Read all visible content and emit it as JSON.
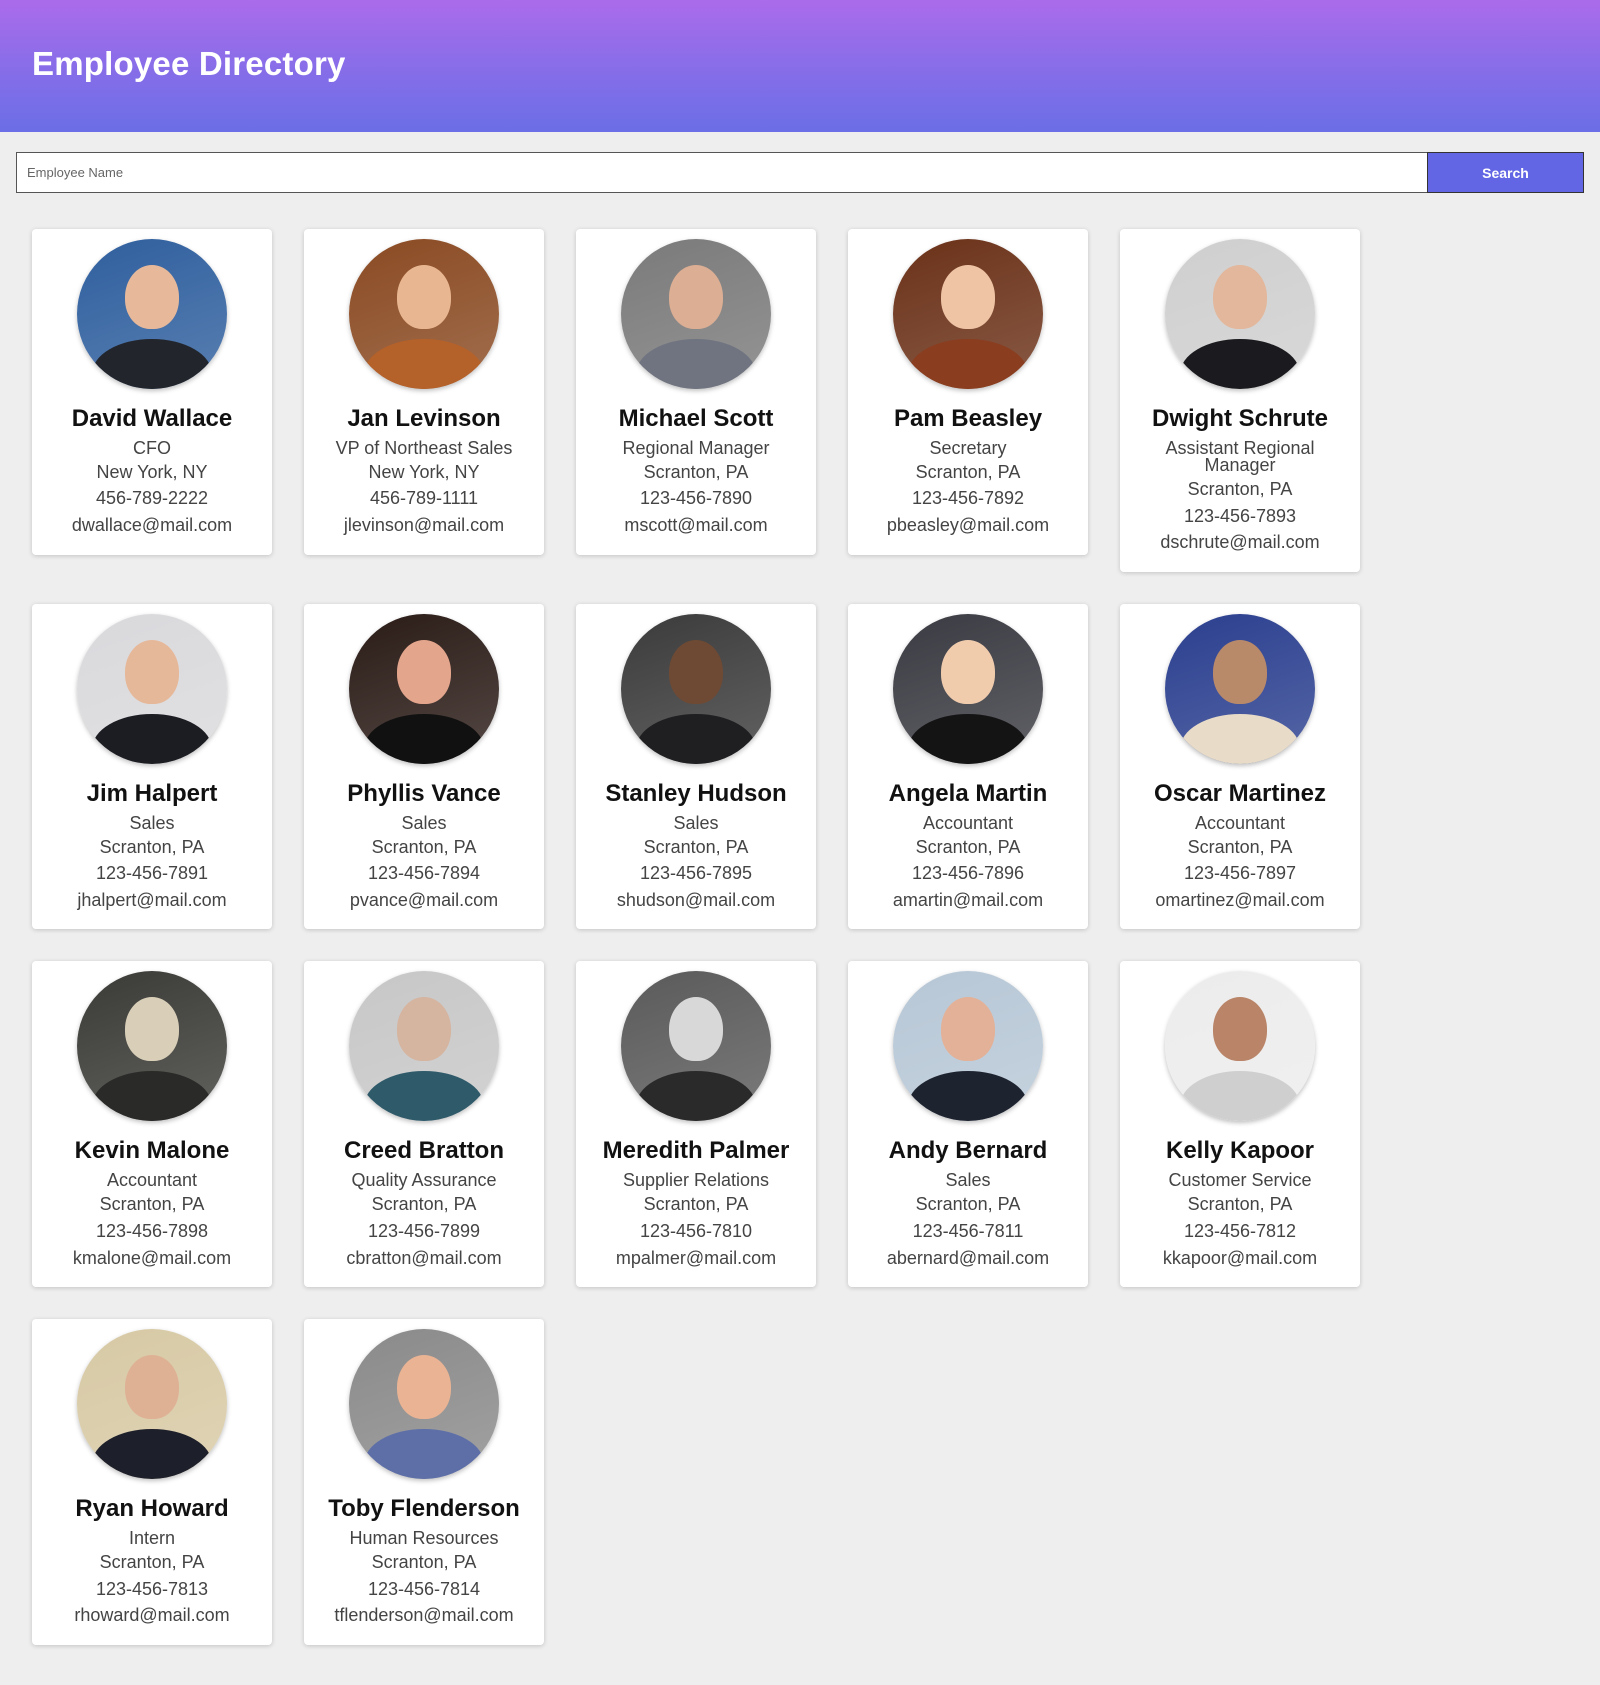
{
  "header": {
    "title": "Employee Directory"
  },
  "search": {
    "placeholder": "Employee Name",
    "button_label": "Search"
  },
  "employees": [
    {
      "name": "David Wallace",
      "title": "CFO",
      "location": "New York, NY",
      "phone": "456-789-2222",
      "email": "dwallace@mail.com",
      "bg": "#2f5f9e",
      "skin": "#e7b99a",
      "shirt": "#22252b"
    },
    {
      "name": "Jan Levinson",
      "title": "VP of Northeast Sales",
      "location": "New York, NY",
      "phone": "456-789-1111",
      "email": "jlevinson@mail.com",
      "bg": "#8a4a22",
      "skin": "#e8b791",
      "shirt": "#b5612a"
    },
    {
      "name": "Michael Scott",
      "title": "Regional Manager",
      "location": "Scranton, PA",
      "phone": "123-456-7890",
      "email": "mscott@mail.com",
      "bg": "#7a7a7a",
      "skin": "#dcae93",
      "shirt": "#6f7480"
    },
    {
      "name": "Pam Beasley",
      "title": "Secretary",
      "location": "Scranton, PA",
      "phone": "123-456-7892",
      "email": "pbeasley@mail.com",
      "bg": "#6b3118",
      "skin": "#eec4a5",
      "shirt": "#8a3d1f"
    },
    {
      "name": "Dwight Schrute",
      "title": "Assistant Regional Manager",
      "location": "Scranton, PA",
      "phone": "123-456-7893",
      "email": "dschrute@mail.com",
      "bg": "#cfcfcf",
      "skin": "#e3b79c",
      "shirt": "#1b1b1f"
    },
    {
      "name": "Jim Halpert",
      "title": "Sales",
      "location": "Scranton, PA",
      "phone": "123-456-7891",
      "email": "jhalpert@mail.com",
      "bg": "#d9d9dc",
      "skin": "#e6b89a",
      "shirt": "#1c1d22"
    },
    {
      "name": "Phyllis Vance",
      "title": "Sales",
      "location": "Scranton, PA",
      "phone": "123-456-7894",
      "email": "pvance@mail.com",
      "bg": "#2a1b16",
      "skin": "#e4a58d",
      "shirt": "#111111"
    },
    {
      "name": "Stanley Hudson",
      "title": "Sales",
      "location": "Scranton, PA",
      "phone": "123-456-7895",
      "email": "shudson@mail.com",
      "bg": "#3b3b3b",
      "skin": "#6e4a34",
      "shirt": "#1f1f22"
    },
    {
      "name": "Angela Martin",
      "title": "Accountant",
      "location": "Scranton, PA",
      "phone": "123-456-7896",
      "email": "amartin@mail.com",
      "bg": "#3a3a42",
      "skin": "#f0ccad",
      "shirt": "#141414"
    },
    {
      "name": "Oscar Martinez",
      "title": "Accountant",
      "location": "Scranton, PA",
      "phone": "123-456-7897",
      "email": "omartinez@mail.com",
      "bg": "#2b3f8f",
      "skin": "#b98a6a",
      "shirt": "#e8dcc8"
    },
    {
      "name": "Kevin Malone",
      "title": "Accountant",
      "location": "Scranton, PA",
      "phone": "123-456-7898",
      "email": "kmalone@mail.com",
      "bg": "#3a3a36",
      "skin": "#d9cfb8",
      "shirt": "#2a2a28"
    },
    {
      "name": "Creed Bratton",
      "title": "Quality Assurance",
      "location": "Scranton, PA",
      "phone": "123-456-7899",
      "email": "cbratton@mail.com",
      "bg": "#c7c7c7",
      "skin": "#d5b4a0",
      "shirt": "#2f5a6a"
    },
    {
      "name": "Meredith Palmer",
      "title": "Supplier Relations",
      "location": "Scranton, PA",
      "phone": "123-456-7810",
      "email": "mpalmer@mail.com",
      "bg": "#5a5a5a",
      "skin": "#d8d8d8",
      "shirt": "#2a2a2a"
    },
    {
      "name": "Andy Bernard",
      "title": "Sales",
      "location": "Scranton, PA",
      "phone": "123-456-7811",
      "email": "abernard@mail.com",
      "bg": "#b7c7d6",
      "skin": "#e3b197",
      "shirt": "#1e2330"
    },
    {
      "name": "Kelly Kapoor",
      "title": "Customer Service",
      "location": "Scranton, PA",
      "phone": "123-456-7812",
      "email": "kkapoor@mail.com",
      "bg": "#ececec",
      "skin": "#b98468",
      "shirt": "#cfcfcf"
    },
    {
      "name": "Ryan Howard",
      "title": "Intern",
      "location": "Scranton, PA",
      "phone": "123-456-7813",
      "email": "rhoward@mail.com",
      "bg": "#d7c9a4",
      "skin": "#deb194",
      "shirt": "#1d1f2a"
    },
    {
      "name": "Toby Flenderson",
      "title": "Human Resources",
      "location": "Scranton, PA",
      "phone": "123-456-7814",
      "email": "tflenderson@mail.com",
      "bg": "#8a8a8a",
      "skin": "#e9b394",
      "shirt": "#5e6fa8"
    }
  ]
}
